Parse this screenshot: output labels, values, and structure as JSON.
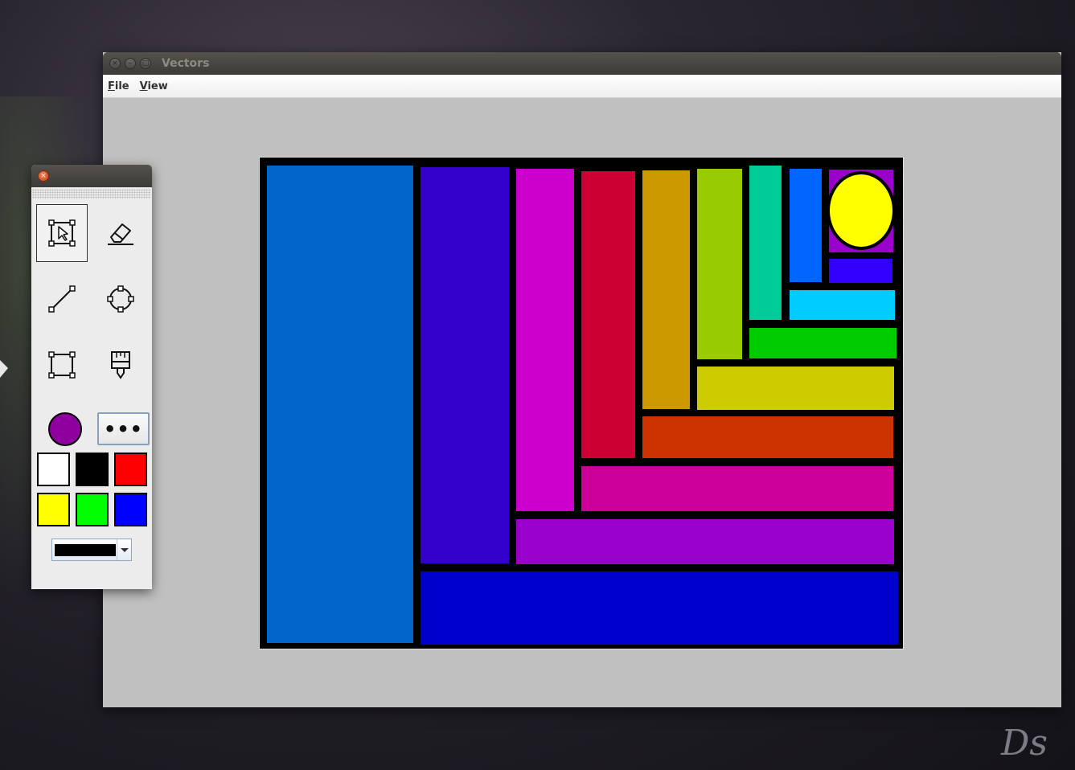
{
  "window": {
    "title": "Vectors",
    "buttons": [
      "close-icon",
      "minimize-icon",
      "maximize-icon"
    ]
  },
  "menu": {
    "file": {
      "mnemonic": "F",
      "rest": "ile"
    },
    "view": {
      "mnemonic": "V",
      "rest": "iew"
    }
  },
  "canvas": {
    "background": "#000000",
    "shapes": [
      {
        "type": "rect",
        "fill": "#0066CC"
      },
      {
        "type": "rect",
        "fill": "#3300CC"
      },
      {
        "type": "rect",
        "fill": "#CC00CC"
      },
      {
        "type": "rect",
        "fill": "#CC0033"
      },
      {
        "type": "rect",
        "fill": "#CC9900"
      },
      {
        "type": "rect",
        "fill": "#99CC00"
      },
      {
        "type": "rect",
        "fill": "#00CC99"
      },
      {
        "type": "rect",
        "fill": "#0066FF"
      },
      {
        "type": "rect",
        "fill": "#9900CC"
      },
      {
        "type": "ellipse",
        "fill": "#FFFF00"
      },
      {
        "type": "rect",
        "fill": "#3300FF"
      },
      {
        "type": "rect",
        "fill": "#00CCFF"
      },
      {
        "type": "rect",
        "fill": "#00CC00"
      },
      {
        "type": "rect",
        "fill": "#CCCC00"
      },
      {
        "type": "rect",
        "fill": "#CC3300"
      },
      {
        "type": "rect",
        "fill": "#CC0099"
      },
      {
        "type": "rect",
        "fill": "#9900CC"
      },
      {
        "type": "rect",
        "fill": "#0000CC"
      }
    ]
  },
  "toolbox": {
    "tools": [
      {
        "name": "select-tool",
        "icon": "select-icon",
        "selected": true
      },
      {
        "name": "eraser-tool",
        "icon": "eraser-icon",
        "selected": false
      },
      {
        "name": "line-tool",
        "icon": "line-icon",
        "selected": false
      },
      {
        "name": "ellipse-tool",
        "icon": "ellipse-icon",
        "selected": false
      },
      {
        "name": "rectangle-tool",
        "icon": "rectangle-icon",
        "selected": false
      },
      {
        "name": "paint-tool",
        "icon": "paintbrush-icon",
        "selected": false
      }
    ],
    "fill_color": "#8E019E",
    "more_label": "•••",
    "palette": [
      "#FFFFFF",
      "#000000",
      "#FF0000",
      "#FFFF00",
      "#00FF00",
      "#0000FF"
    ],
    "stroke_color": "#000000"
  },
  "desktop": {
    "signature": "Ds"
  }
}
